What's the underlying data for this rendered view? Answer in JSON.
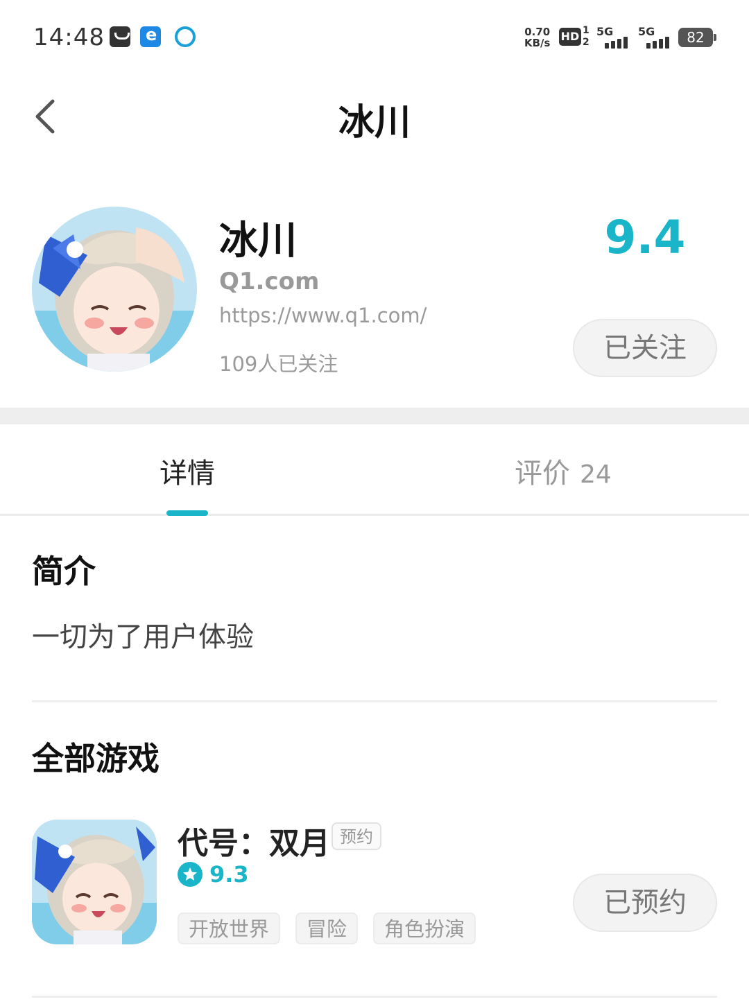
{
  "status_bar": {
    "time": "14:48",
    "net_speed_value": "0.70",
    "net_speed_unit": "KB/s",
    "hd_label": "HD",
    "hd_sim_top": "1",
    "hd_sim_bottom": "2",
    "sim1_label": "5G",
    "sim2_label": "5G",
    "battery": "82",
    "icons": [
      "message-icon",
      "app-e-icon",
      "china-mobile-icon"
    ]
  },
  "nav": {
    "title": "冰川",
    "back_icon": "chevron-left-icon"
  },
  "profile": {
    "name": "冰川",
    "domain": "Q1.com",
    "url": "https://www.q1.com/",
    "followers": "109人已关注",
    "score": "9.4",
    "follow_label": "已关注"
  },
  "tabs": [
    {
      "label": "详情",
      "count": "",
      "active": true
    },
    {
      "label": "评价",
      "count": "24",
      "active": false
    }
  ],
  "intro": {
    "title": "简介",
    "text": "一切为了用户体验"
  },
  "games": {
    "title": "全部游戏",
    "items": [
      {
        "name": "代号：双月",
        "badge": "预约",
        "rating": "9.3",
        "tags": [
          "开放世界",
          "冒险",
          "角色扮演"
        ],
        "action_label": "已预约"
      }
    ]
  },
  "colors": {
    "accent": "#1ab5c8",
    "text_primary": "#111111",
    "text_secondary": "#999999",
    "button_bg": "#f3f3f3"
  }
}
